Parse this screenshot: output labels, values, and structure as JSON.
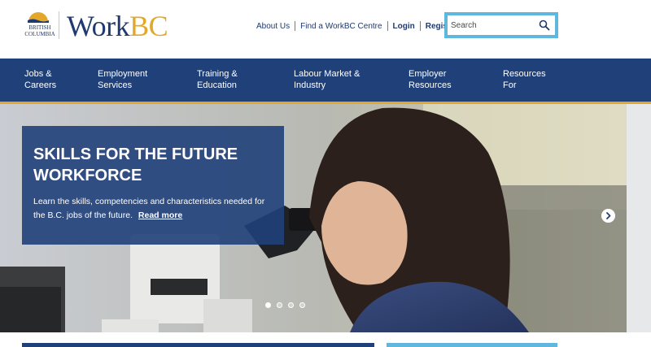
{
  "logo": {
    "province_line1": "BRITISH",
    "province_line2": "COLUMBIA",
    "brand_work": "Work",
    "brand_bc": "BC"
  },
  "header": {
    "links": [
      {
        "label": "About Us"
      },
      {
        "label": "Find a WorkBC Centre"
      },
      {
        "label": "Login"
      },
      {
        "label": "Register"
      }
    ],
    "search": {
      "placeholder": "Search",
      "icon": "magnifier-icon"
    }
  },
  "nav": {
    "items": [
      {
        "line1": "Jobs &",
        "line2": "Careers"
      },
      {
        "line1": "Employment",
        "line2": "Services"
      },
      {
        "line1": "Training &",
        "line2": "Education"
      },
      {
        "line1": "Labour Market &",
        "line2": "Industry"
      },
      {
        "line1": "Employer",
        "line2": "Resources"
      },
      {
        "line1": "Resources",
        "line2": "For"
      }
    ]
  },
  "hero": {
    "title": "SKILLS FOR THE FUTURE WORKFORCE",
    "description": "Learn the skills, competencies and characteristics needed for the B.C. jobs of the future.",
    "read_more": "Read more",
    "next_icon": "chevron-right-icon",
    "slide_count": 4,
    "active_slide": 1
  },
  "colors": {
    "navy": "#20407a",
    "gold": "#e3a82b",
    "sky": "#5fb7de",
    "white": "#ffffff"
  }
}
